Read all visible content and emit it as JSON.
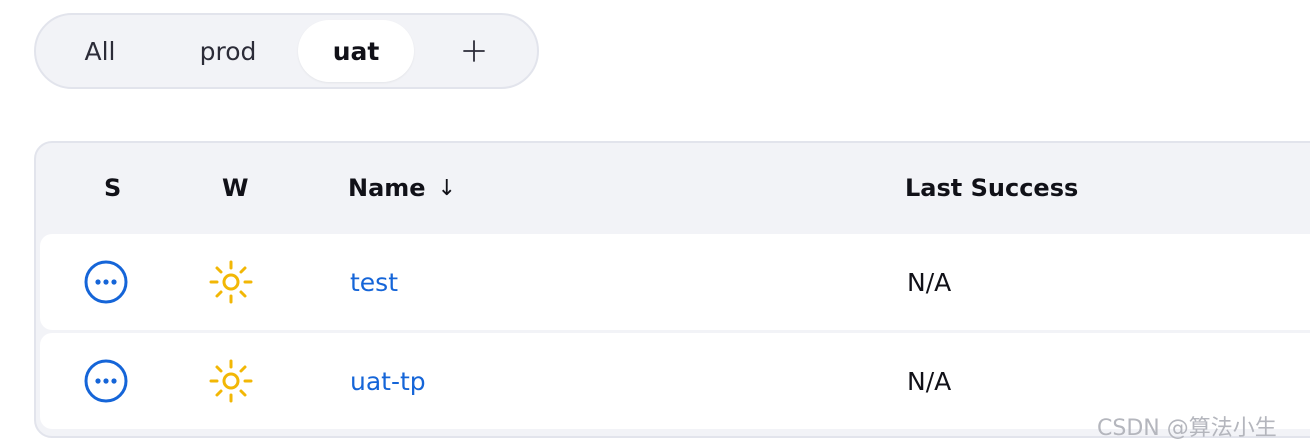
{
  "tabs": [
    {
      "label": "All",
      "active": false
    },
    {
      "label": "prod",
      "active": false
    },
    {
      "label": "uat",
      "active": true
    }
  ],
  "add_tab_icon": "plus-icon",
  "table": {
    "headers": {
      "status": "S",
      "weather": "W",
      "name": "Name",
      "name_sort_indicator": "↓",
      "last_success": "Last Success"
    },
    "rows": [
      {
        "status_icon": "in-progress-ellipsis-icon",
        "weather_icon": "sunny-icon",
        "name": "test",
        "last_success": "N/A"
      },
      {
        "status_icon": "in-progress-ellipsis-icon",
        "weather_icon": "sunny-icon",
        "name": "uat-tp",
        "last_success": "N/A"
      }
    ]
  },
  "colors": {
    "accent_link": "#1565d8",
    "status_blue": "#1565d8",
    "sun_yellow": "#f2b705",
    "panel_bg": "#f2f3f7"
  },
  "watermark": "CSDN @算法小生"
}
